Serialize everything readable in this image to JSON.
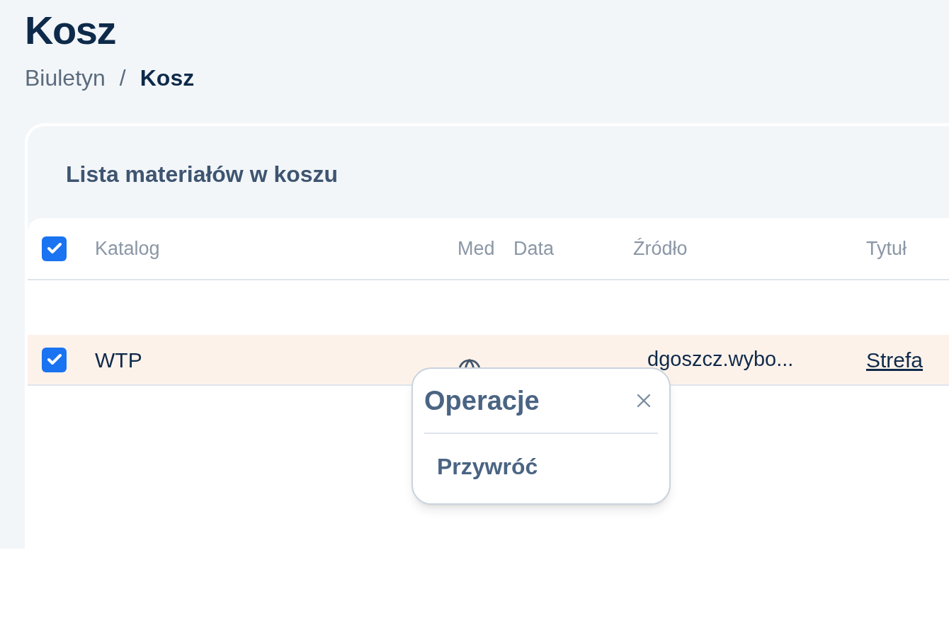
{
  "page_title": "Kosz",
  "breadcrumb_separator": "/",
  "breadcrumb": [
    {
      "label": "Biuletyn",
      "current": false
    },
    {
      "label": "Kosz",
      "current": true
    }
  ],
  "card": {
    "title": "Lista materiałów w koszu"
  },
  "table": {
    "select_all_checked": true,
    "columns": [
      "Katalog",
      "Med",
      "Data",
      "Źródło",
      "Tytuł"
    ],
    "rows": [
      {
        "selected": true,
        "checked": true,
        "katalog": "WTP",
        "source": "dgoszcz.wybo...",
        "title": "Strefa"
      }
    ]
  },
  "popup": {
    "title": "Operacje",
    "items": [
      "Przywróć"
    ]
  }
}
